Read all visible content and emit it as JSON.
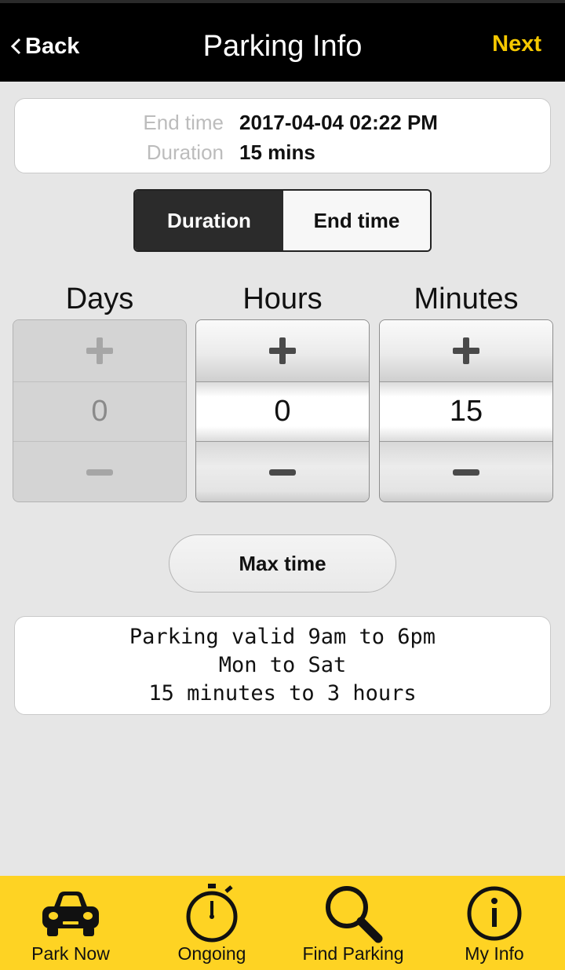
{
  "header": {
    "back_label": "Back",
    "title": "Parking Info",
    "next_label": "Next",
    "accent_color": "#f5c800"
  },
  "summary": {
    "end_time_label": "End time",
    "end_time_value": "2017-04-04 02:22 PM",
    "duration_label": "Duration",
    "duration_value": "15 mins"
  },
  "mode_toggle": {
    "options": [
      "Duration",
      "End time"
    ],
    "selected": "Duration"
  },
  "steppers": [
    {
      "label": "Days",
      "value": "0",
      "enabled": false
    },
    {
      "label": "Hours",
      "value": "0",
      "enabled": true
    },
    {
      "label": "Minutes",
      "value": "15",
      "enabled": true
    }
  ],
  "max_time_label": "Max time",
  "info": {
    "lines": [
      "Parking valid 9am to 6pm",
      "Mon to Sat",
      "15 minutes to 3 hours"
    ]
  },
  "bottom_nav": {
    "background": "#fed323",
    "items": [
      {
        "label": "Park Now",
        "icon": "car-icon"
      },
      {
        "label": "Ongoing",
        "icon": "stopwatch-icon"
      },
      {
        "label": "Find Parking",
        "icon": "search-icon"
      },
      {
        "label": "My Info",
        "icon": "info-icon"
      }
    ]
  }
}
